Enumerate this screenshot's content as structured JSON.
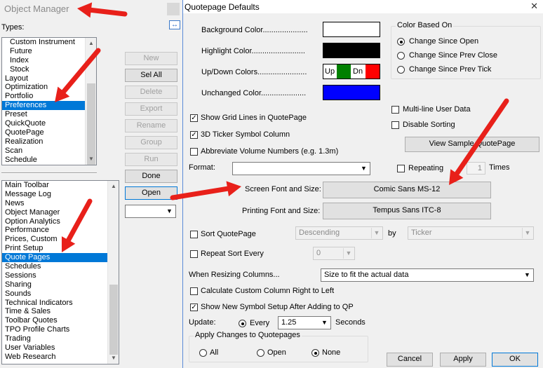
{
  "object_manager": {
    "title": "Object Manager",
    "types_label": "Types:",
    "types": [
      {
        "label": "Custom Instrument",
        "indent": true
      },
      {
        "label": "Future",
        "indent": true
      },
      {
        "label": "Index",
        "indent": true
      },
      {
        "label": "Stock",
        "indent": true
      },
      {
        "label": "Layout"
      },
      {
        "label": "Optimization"
      },
      {
        "label": "Portfolio"
      },
      {
        "label": "Preferences",
        "selected": true
      },
      {
        "label": "Preset"
      },
      {
        "label": "QuickQuote"
      },
      {
        "label": "QuotePage"
      },
      {
        "label": "Realization"
      },
      {
        "label": "Scan"
      },
      {
        "label": "Schedule"
      }
    ],
    "items": [
      {
        "label": "Main Toolbar"
      },
      {
        "label": "Message Log"
      },
      {
        "label": "News"
      },
      {
        "label": "Object Manager"
      },
      {
        "label": "Option Analytics"
      },
      {
        "label": "Performance"
      },
      {
        "label": "Prices, Custom"
      },
      {
        "label": "Print Setup"
      },
      {
        "label": "Quote Pages",
        "selected": true
      },
      {
        "label": "Schedules"
      },
      {
        "label": "Sessions"
      },
      {
        "label": "Sharing"
      },
      {
        "label": "Sounds"
      },
      {
        "label": "Technical Indicators"
      },
      {
        "label": "Time & Sales"
      },
      {
        "label": "Toolbar Quotes"
      },
      {
        "label": "TPO Profile Charts"
      },
      {
        "label": "Trading"
      },
      {
        "label": "User Variables"
      },
      {
        "label": "Web Research"
      }
    ],
    "buttons": {
      "new": "New",
      "sel_all": "Sel All",
      "delete": "Delete",
      "export": "Export",
      "rename": "Rename",
      "group": "Group",
      "run": "Run",
      "done": "Done",
      "open": "Open"
    },
    "combo_value": ""
  },
  "dialog": {
    "title": "Quotepage Defaults",
    "close": "✕",
    "background_color_label": "Background Color.....................",
    "highlight_color_label": "Highlight Color.........................",
    "updown_colors_label": "Up/Down Colors.......................",
    "unchanged_color_label": "Unchanged Color.....................",
    "up_text": "Up",
    "dn_text": "Dn",
    "colors": {
      "background": "#ffffff",
      "highlight": "#000000",
      "up": "#008000",
      "down": "#ff0000",
      "unchanged": "#0000ff"
    },
    "color_based_on": {
      "legend": "Color Based On",
      "options": [
        "Change Since Open",
        "Change Since Prev Close",
        "Change Since Prev Tick"
      ],
      "selected": "Change Since Open"
    },
    "show_grid_lines": {
      "label": "Show Grid Lines in QuotePage",
      "checked": true
    },
    "ticker_3d": {
      "label": "3D Ticker Symbol Column",
      "checked": true
    },
    "abbreviate_volume": {
      "label": "Abbreviate Volume Numbers (e.g. 1.3m)",
      "checked": false
    },
    "multiline_user_data": {
      "label": "Multi-line User Data",
      "checked": false
    },
    "disable_sorting": {
      "label": "Disable Sorting",
      "checked": false
    },
    "view_sample_button": "View Sample QuotePage",
    "format_label": "Format:",
    "format_value": "",
    "repeating": {
      "label": "Repeating",
      "value": "1",
      "unit": "Times",
      "checked": false
    },
    "screen_font_label": "Screen Font and Size:",
    "screen_font_value": "Comic Sans MS-12",
    "printing_font_label": "Printing Font and Size:",
    "printing_font_value": "Tempus Sans ITC-8",
    "sort_quotepage": {
      "label": "Sort QuotePage",
      "checked": false,
      "order": "Descending",
      "by_label": "by",
      "by_value": "Ticker"
    },
    "repeat_sort": {
      "label": "Repeat Sort Every",
      "checked": false,
      "value": "0"
    },
    "resizing_label": "When Resizing Columns...",
    "resizing_value": "Size to fit the actual data",
    "custom_right_to_left": {
      "label": "Calculate Custom Column Right to Left",
      "checked": false
    },
    "new_symbol_setup": {
      "label": "Show New Symbol Setup After Adding to QP",
      "checked": true
    },
    "update": {
      "label": "Update:",
      "every_label": "Every",
      "value": "1.25",
      "unit": "Seconds"
    },
    "apply_changes": {
      "legend": "Apply Changes to Quotepages",
      "options": [
        "All",
        "Open",
        "None"
      ],
      "selected": "None"
    },
    "buttons": {
      "cancel": "Cancel",
      "apply": "Apply",
      "ok": "OK"
    }
  },
  "annotations": {
    "arrow_color": "#e8201a"
  }
}
